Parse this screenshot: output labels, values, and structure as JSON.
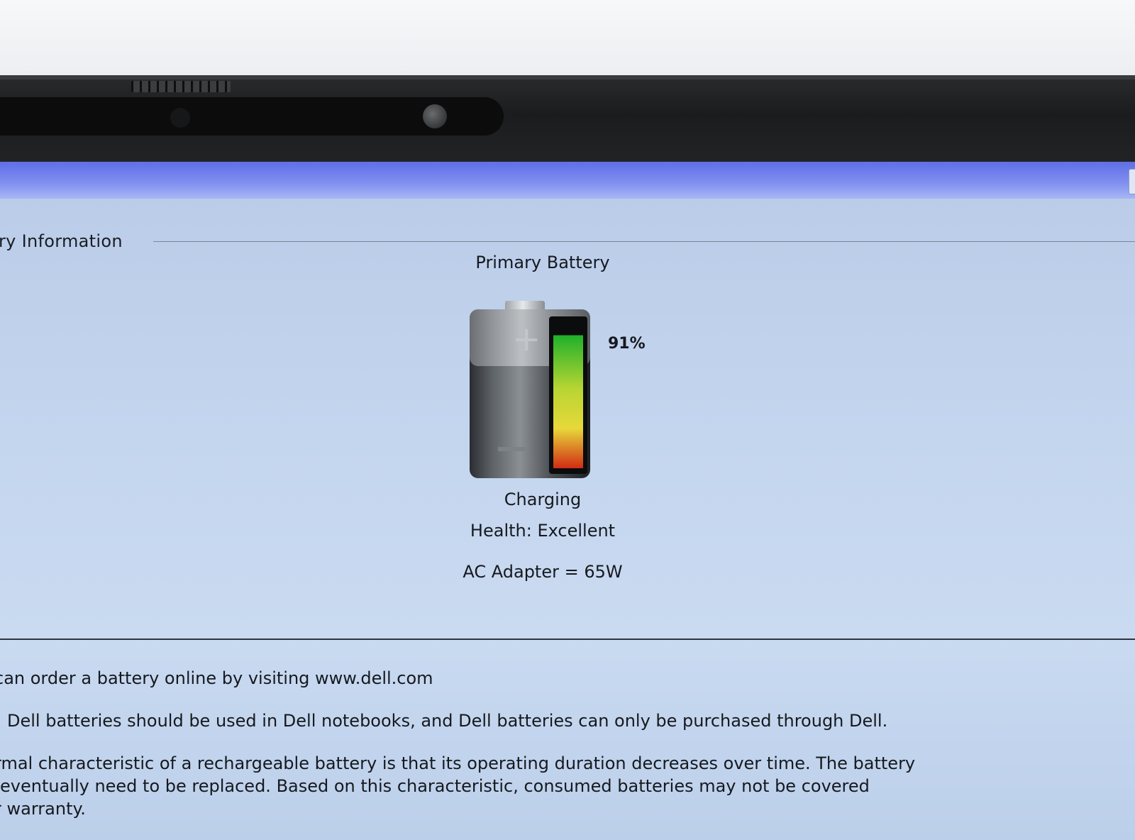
{
  "group": {
    "label": "ry Information"
  },
  "battery": {
    "name": "Primary Battery",
    "charge_percent": 91,
    "charge_label": "91%",
    "status": "Charging",
    "health": "Health: Excellent",
    "adapter": "AC Adapter = 65W",
    "gauge_colors": [
      "#1fb02a",
      "#b7d533",
      "#e7d83a",
      "#d12c14"
    ]
  },
  "notes": [
    [
      "can order a battery online by visiting www.dell.com"
    ],
    [
      "Dell batteries should be used in Dell notebooks, and Dell batteries can only be purchased through Dell."
    ],
    [
      "rmal characteristic of a rechargeable battery is that its operating duration decreases over time.  The battery",
      "eventually need to be replaced.  Based on this characteristic, consumed batteries may not be covered",
      "r warranty."
    ]
  ]
}
